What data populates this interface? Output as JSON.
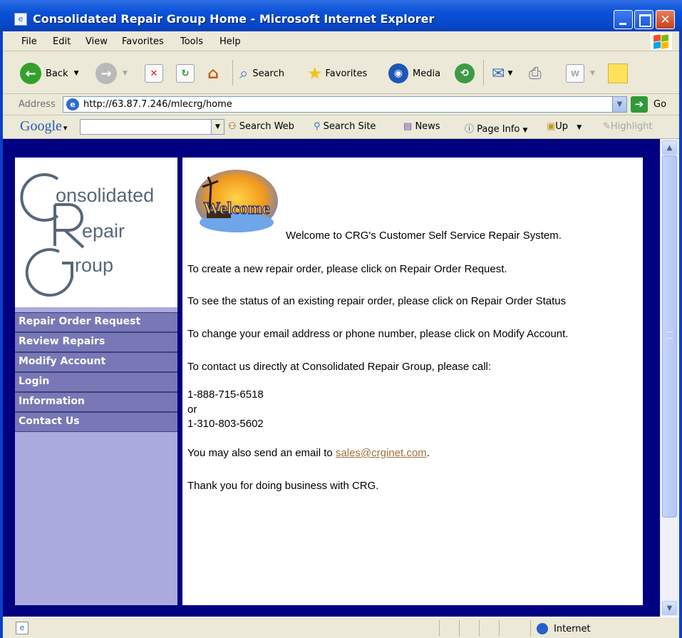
{
  "window": {
    "title": "Consolidated Repair Group Home - Microsoft Internet Explorer"
  },
  "menubar": [
    "File",
    "Edit",
    "View",
    "Favorites",
    "Tools",
    "Help"
  ],
  "toolbar": {
    "back": "Back",
    "search": "Search",
    "favorites": "Favorites",
    "media": "Media"
  },
  "address": {
    "label": "Address",
    "url": "http://63.87.7.246/mlecrg/home",
    "go": "Go"
  },
  "googlebar": {
    "logo": "Google",
    "search_web": "Search Web",
    "search_site": "Search Site",
    "news": "News",
    "page_info": "Page Info",
    "up": "Up",
    "highlight": "Highlight"
  },
  "logo": {
    "line1": "onsolidated",
    "line2": "epair",
    "line3": "roup"
  },
  "nav": [
    "Repair Order Request",
    "Review Repairs",
    "Modify Account",
    "Login",
    "Information",
    "Contact Us"
  ],
  "welcome_image_text": "Welcome",
  "main": {
    "welcome": "Welcome to CRG's Customer Self Service Repair System.",
    "create": "To create a new repair order, please click on Repair Order Request.",
    "status": "To see the status of an existing repair order, please click on Repair Order Status",
    "change": "To change your email address or phone number, please click on Modify Account.",
    "contact": "To contact us directly at Consolidated Repair Group, please call:",
    "phone1": "1-888-715-6518",
    "or": "or",
    "phone2": "1-310-803-5602",
    "email_prefix": "You may also send an email to ",
    "email": "sales@crginet.com",
    "email_suffix": ".",
    "thanks": "Thank you for doing business with CRG."
  },
  "statusbar": {
    "zone": "Internet"
  }
}
